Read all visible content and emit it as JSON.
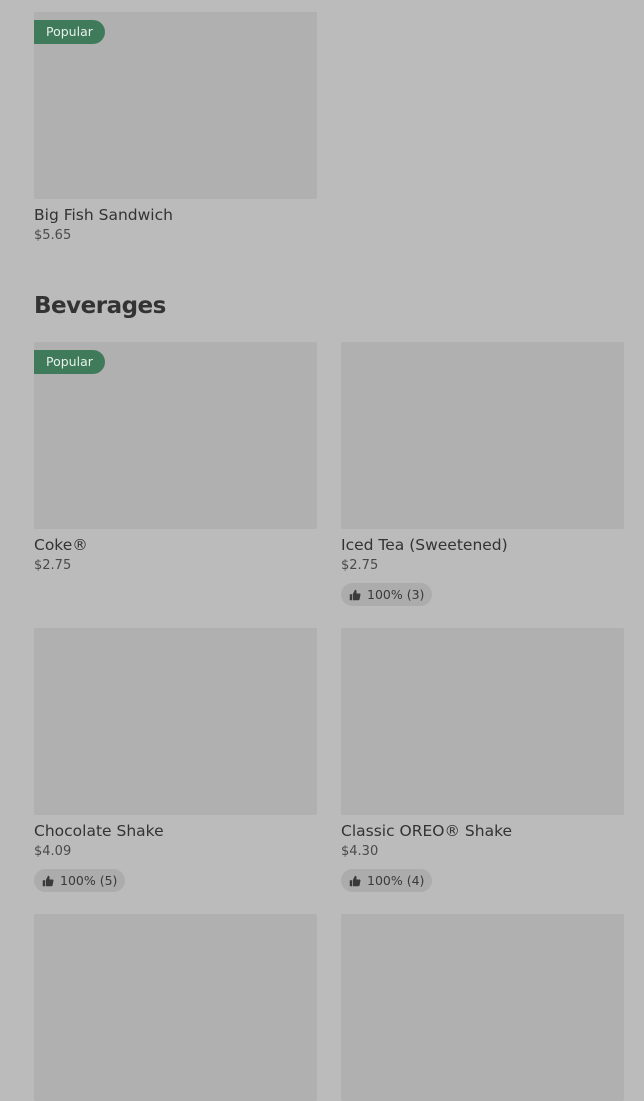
{
  "top_items": [
    {
      "name": "Big Fish Sandwich",
      "price": "$5.65",
      "badge": "Popular"
    }
  ],
  "beverages": {
    "title": "Beverages",
    "items": [
      {
        "name": "Coke®",
        "price": "$2.75",
        "badge": "Popular",
        "rating": ""
      },
      {
        "name": "Iced Tea (Sweetened)",
        "price": "$2.75",
        "badge": "",
        "rating": "100% (3)"
      },
      {
        "name": "Chocolate Shake",
        "price": "$4.09",
        "badge": "",
        "rating": "100% (5)"
      },
      {
        "name": "Classic OREO® Shake",
        "price": "$4.30",
        "badge": "",
        "rating": "100% (4)"
      }
    ]
  },
  "colors": {
    "page_background": "#bbbbbb",
    "image_placeholder": "#b0b0b0",
    "popular_badge": "#3f7b5b",
    "rating_chip": "#acacac"
  },
  "icons": {
    "rating": "thumbs-up-icon"
  }
}
